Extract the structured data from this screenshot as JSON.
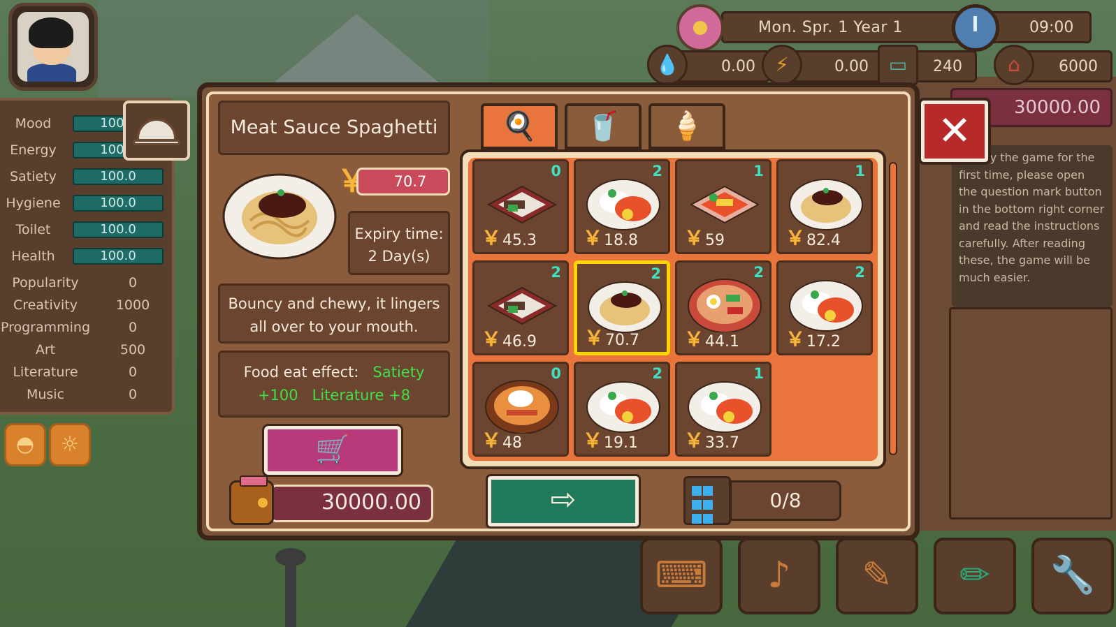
{
  "hud": {
    "date": "Mon.  Spr.  1    Year 1",
    "time": "09:00",
    "water": "0.00",
    "electricity": "0.00",
    "screen_value": "240",
    "house_value": "6000",
    "money_right": "30000.00"
  },
  "stats": [
    {
      "label": "Mood",
      "value": "100.0",
      "type": "bar"
    },
    {
      "label": "Energy",
      "value": "100.0",
      "type": "bar"
    },
    {
      "label": "Satiety",
      "value": "100.0",
      "type": "bar"
    },
    {
      "label": "Hygiene",
      "value": "100.0",
      "type": "bar"
    },
    {
      "label": "Toilet",
      "value": "100.0",
      "type": "bar"
    },
    {
      "label": "Health",
      "value": "100.0",
      "type": "bar"
    },
    {
      "label": "Popularity",
      "value": "0",
      "type": "num"
    },
    {
      "label": "Creativity",
      "value": "1000",
      "type": "num"
    },
    {
      "label": "Programming",
      "value": "0",
      "type": "num"
    },
    {
      "label": "Art",
      "value": "500",
      "type": "num"
    },
    {
      "label": "Literature",
      "value": "0",
      "type": "num"
    },
    {
      "label": "Music",
      "value": "0",
      "type": "num"
    }
  ],
  "tutorial": "... play the game for the first time, please open the question mark button in the bottom right corner and read the instructions carefully. After reading these, the game will be much easier.",
  "item": {
    "title": "Meat Sauce Spaghetti",
    "price": "70.7",
    "expiry_line1": "Expiry time:",
    "expiry_line2": "2 Day(s)",
    "description": "Bouncy and chewy, it lingers all over to your mouth.",
    "effect_label": "Food eat effect:",
    "effect_satiety": "Satiety",
    "effect_satiety_val": "+100",
    "effect_literature": "Literature +8"
  },
  "wallet": "30000.00",
  "storage": "0/8",
  "icons": {
    "yen": "￥",
    "cart": "🛒",
    "arrow": "⇨",
    "close": "✕",
    "food_tab": "🍳",
    "drink_tab": "🥤",
    "dessert_tab": "🍦"
  },
  "foods": [
    {
      "price": "45.3",
      "qty": "0",
      "kind": "bento"
    },
    {
      "price": "18.8",
      "qty": "2",
      "kind": "rice"
    },
    {
      "price": "59",
      "qty": "1",
      "kind": "box"
    },
    {
      "price": "82.4",
      "qty": "1",
      "kind": "spaghetti"
    },
    {
      "price": "46.9",
      "qty": "2",
      "kind": "bento"
    },
    {
      "price": "70.7",
      "qty": "2",
      "kind": "spaghetti",
      "selected": true
    },
    {
      "price": "44.1",
      "qty": "2",
      "kind": "bibimbap"
    },
    {
      "price": "17.2",
      "qty": "2",
      "kind": "rice"
    },
    {
      "price": "48",
      "qty": "0",
      "kind": "bowl"
    },
    {
      "price": "19.1",
      "qty": "2",
      "kind": "rice"
    },
    {
      "price": "33.7",
      "qty": "1",
      "kind": "rice"
    }
  ]
}
